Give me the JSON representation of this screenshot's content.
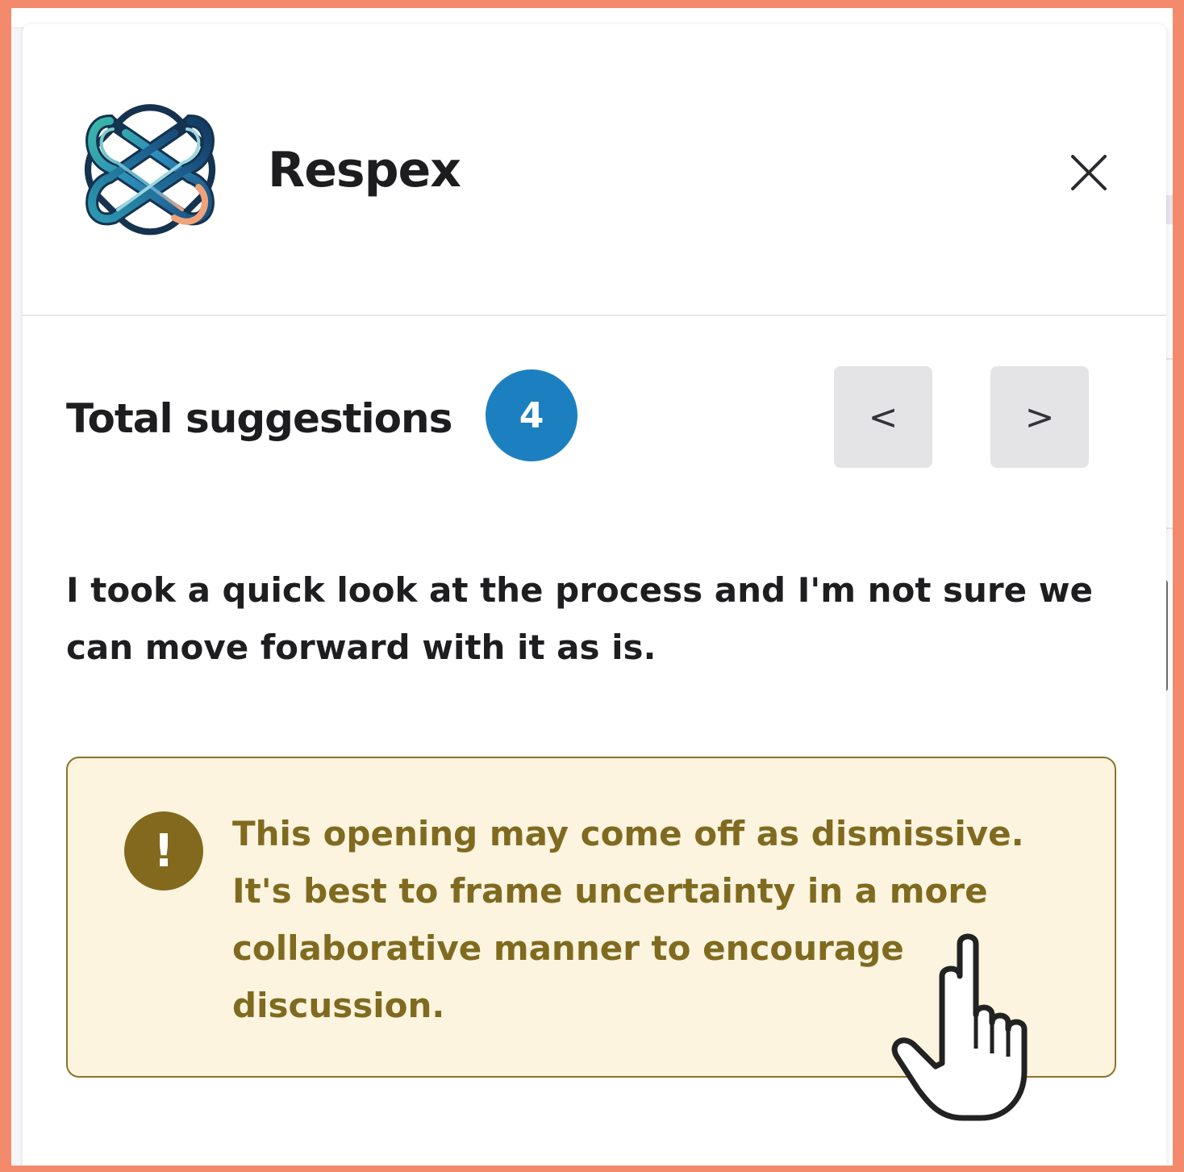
{
  "app": {
    "name": "Respex",
    "logo_icon": "interlocking-knot-logo",
    "close_icon": "close-icon"
  },
  "suggestions": {
    "label": "Total suggestions",
    "count": "4",
    "prev_label": "<",
    "next_label": ">"
  },
  "message": {
    "text": "I took a quick look at the process and I'm not sure we can move forward with it as is."
  },
  "alert": {
    "icon": "exclamation-icon",
    "icon_glyph": "!",
    "text": "This opening may come off as dismissive. It's best to frame uncertainty in a more collaborative manner to encourage discussion."
  },
  "colors": {
    "frame": "#f28a6b",
    "badge": "#1c80c0",
    "alert_bg": "#fdf4df",
    "alert_border": "#8a7328",
    "alert_text": "#7f6a1f",
    "alert_icon_bg": "#82691e"
  }
}
